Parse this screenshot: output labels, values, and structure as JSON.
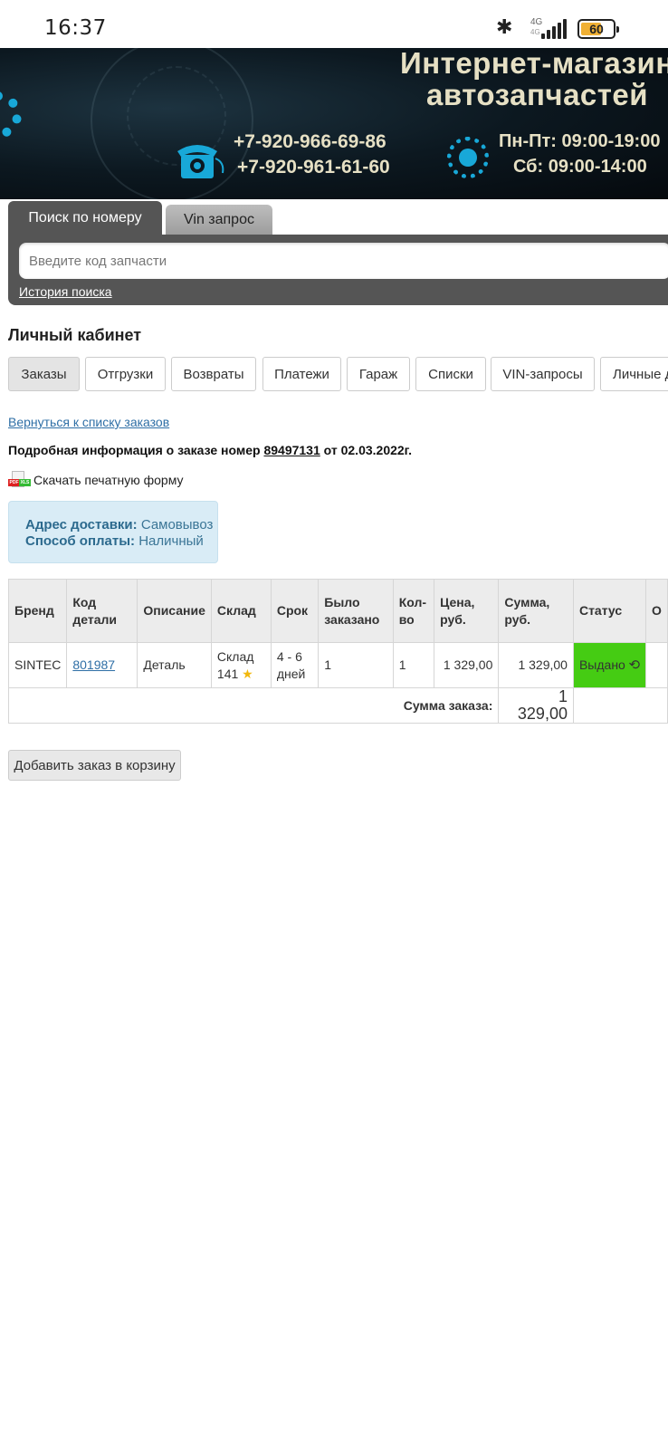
{
  "status_bar": {
    "time": "16:37",
    "network": "4G",
    "network_sub": "4G",
    "battery": "60"
  },
  "banner": {
    "title_line1": "Интернет-магазин",
    "title_line2": "автозапчастей",
    "phone1": "+7-920-966-69-86",
    "phone2": "+7-920-961-61-60",
    "hours_weekdays": "Пн-Пт: 09:00-19:00",
    "hours_saturday": "Сб: 09:00-14:00",
    "accent_color": "#18a8d8"
  },
  "search": {
    "tab_active": "Поиск по номеру",
    "tab_inactive": "Vin запрос",
    "placeholder": "Введите код запчасти",
    "history_link": "История поиска"
  },
  "cabinet": {
    "title": "Личный кабинет",
    "nav": [
      "Заказы",
      "Отгрузки",
      "Возвраты",
      "Платежи",
      "Гараж",
      "Списки",
      "VIN-запросы",
      "Личные д"
    ]
  },
  "order": {
    "back_link": "Вернуться к списку заказов",
    "info_prefix": "Подробная информация о заказе номер ",
    "number": "89497131",
    "info_suffix": " от 02.03.2022г.",
    "print_form": "Скачать печатную форму",
    "delivery_label": "Адрес доставки:",
    "delivery_value": "Самовывоз",
    "payment_label": "Способ оплаты:",
    "payment_value": "Наличный"
  },
  "table": {
    "headers": [
      "Бренд",
      "Код детали",
      "Описание",
      "Склад",
      "Срок",
      "Было заказано",
      "Кол-во",
      "Цена, руб.",
      "Сумма, руб.",
      "Статус",
      "О"
    ],
    "row": {
      "brand": "SINTEC",
      "code": "801987",
      "description": "Деталь",
      "warehouse": "Склад 141",
      "term": "4 - 6 дней",
      "ordered": "1",
      "qty": "1",
      "price": "1 329,00",
      "sum": "1 329,00",
      "status": "Выдано",
      "status_color": "#45cc13"
    },
    "total_label": "Сумма заказа:",
    "total_value": "1 329,00"
  },
  "add_to_cart": "Добавить заказ в корзину"
}
